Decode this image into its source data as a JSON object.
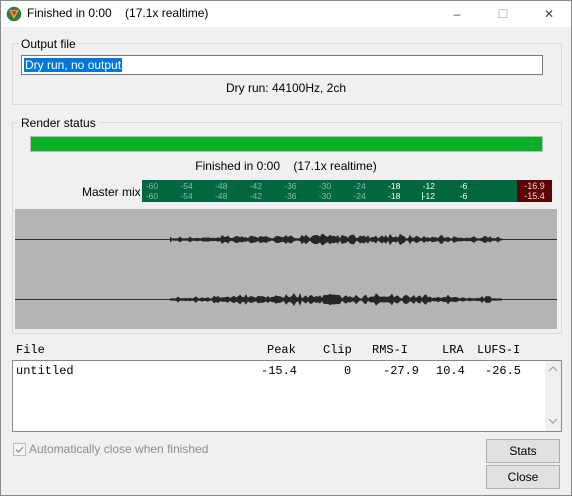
{
  "window": {
    "title": "Finished in 0:00    (17.1x realtime)",
    "minimize_glyph": "–",
    "maximize_glyph": "☐",
    "close_glyph": "✕",
    "icon": "reaper-logo-icon"
  },
  "output_group": {
    "label": "Output file",
    "file_value": "Dry run, no output",
    "info": "Dry run: 44100Hz, 2ch"
  },
  "render_status": {
    "label": "Render status",
    "progress": 1.0,
    "progress_color": "#06b025",
    "status_text": "Finished in 0:00    (17.1x realtime)"
  },
  "meter": {
    "label": "Master mix",
    "ticks": [
      "-60",
      "-54",
      "-48",
      "-42",
      "-36",
      "-30",
      "-24",
      "-18",
      "-12",
      "-6"
    ],
    "peak_left": "-16.9",
    "peak_right": "-15.4",
    "meter_color": "#006840",
    "peak_color": "#5a0404"
  },
  "stats_table": {
    "columns": [
      "File",
      "Peak",
      "Clip",
      "RMS-I",
      "LRA",
      "LUFS-I"
    ],
    "rows": [
      {
        "file": "untitled",
        "peak": "-15.4",
        "clip": "0",
        "rms_i": "-27.9",
        "lra": "10.4",
        "lufs_i": "-26.5"
      }
    ]
  },
  "footer": {
    "auto_close_label": "Automatically close when finished",
    "auto_close_checked": true,
    "stats_button": "Stats",
    "close_button": "Close"
  }
}
